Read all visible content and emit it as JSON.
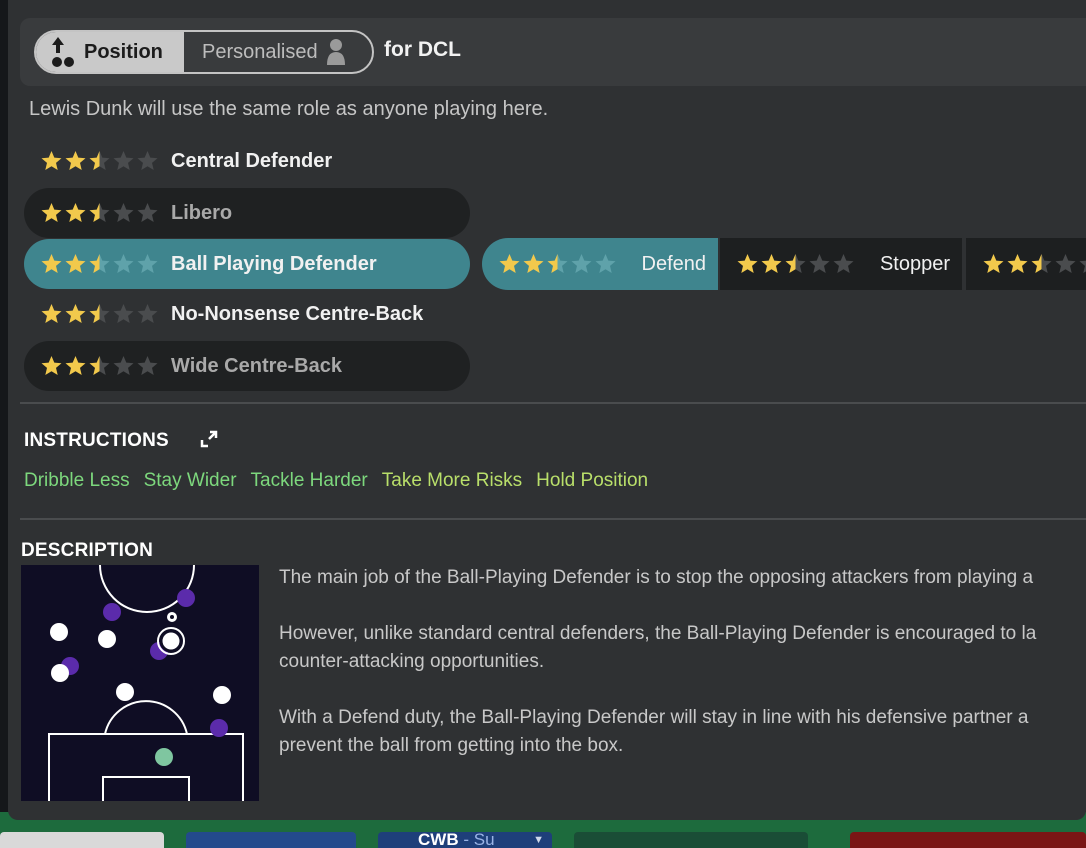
{
  "header": {
    "tab_position": "Position",
    "tab_personalised": "Personalised",
    "for_position": "for DCL"
  },
  "subtitle": "Lewis Dunk will use the same role as anyone playing here.",
  "roles": [
    {
      "label": "Central Defender",
      "rating": 2.5,
      "state": "plain"
    },
    {
      "label": "Libero",
      "rating": 2.5,
      "state": "unavailable"
    },
    {
      "label": "Ball Playing Defender",
      "rating": 2.5,
      "state": "selected"
    },
    {
      "label": "No-Nonsense Centre-Back",
      "rating": 2.5,
      "state": "plain"
    },
    {
      "label": "Wide Centre-Back",
      "rating": 2.5,
      "state": "unavailable"
    }
  ],
  "duties": [
    {
      "label": "Defend",
      "rating": 2.5,
      "selected": true
    },
    {
      "label": "Stopper",
      "rating": 2.5,
      "selected": false
    },
    {
      "label": "",
      "rating": 2.5,
      "selected": false
    }
  ],
  "instructions": {
    "title": "INSTRUCTIONS",
    "items": [
      {
        "label": "Dribble Less",
        "color": "#7dd87d"
      },
      {
        "label": "Stay Wider",
        "color": "#7dd87d"
      },
      {
        "label": "Tackle Harder",
        "color": "#7dd87d"
      },
      {
        "label": "Take More Risks",
        "color": "#b9df6a"
      },
      {
        "label": "Hold Position",
        "color": "#b9df6a"
      }
    ]
  },
  "description": {
    "title": "DESCRIPTION",
    "paragraphs": [
      "The main job of the Ball-Playing Defender is to stop the opposing attackers from playing a",
      "However, unlike standard central defenders, the Ball-Playing Defender is encouraged to la\ncounter-attacking opportunities.",
      "With a Defend duty, the Ball-Playing Defender will stay in line with his defensive partner a\nprevent the ball from getting into the box."
    ]
  },
  "background": {
    "card_label": "CWB",
    "card_duty": "Su"
  },
  "colors": {
    "panel": "#2f3133",
    "accent_teal": "#3f858e",
    "star_gold": "#f2c94c",
    "team_white": "#ffffff",
    "opponent_purple": "#5b2bab",
    "keeper_green": "#7fc6a0"
  }
}
